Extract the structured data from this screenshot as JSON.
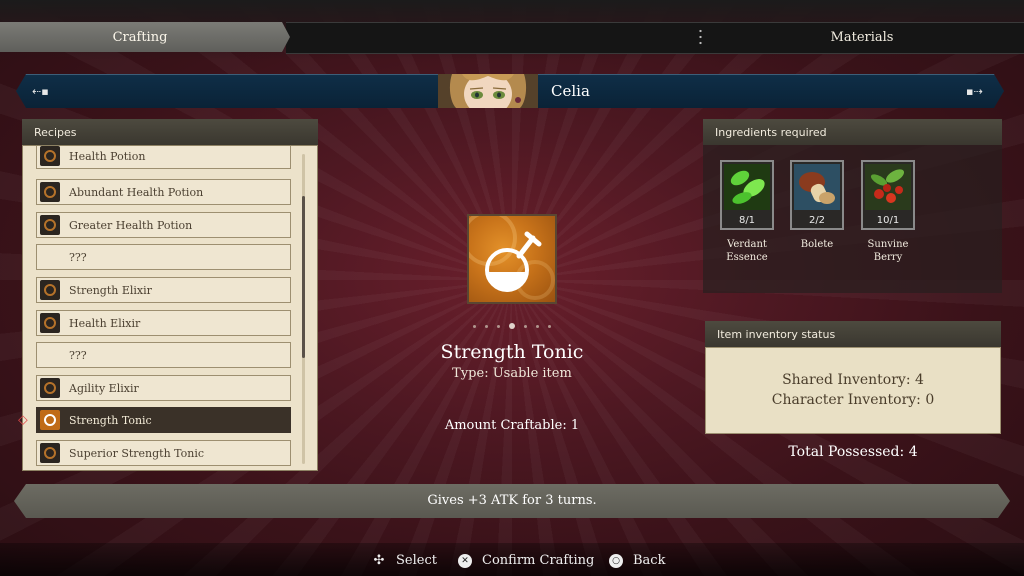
{
  "tabs": {
    "active": "Crafting",
    "other": "Materials"
  },
  "character": {
    "name": "Celia",
    "prev_icon": "arrow-left-icon",
    "next_icon": "arrow-right-icon"
  },
  "recipes": {
    "header": "Recipes",
    "items": [
      {
        "label": "Health Potion",
        "has_icon": true,
        "selected": false
      },
      {
        "label": "Abundant Health Potion",
        "has_icon": true,
        "selected": false
      },
      {
        "label": "Greater Health Potion",
        "has_icon": true,
        "selected": false
      },
      {
        "label": "???",
        "has_icon": false,
        "selected": false
      },
      {
        "label": "Strength Elixir",
        "has_icon": true,
        "selected": false
      },
      {
        "label": "Health Elixir",
        "has_icon": true,
        "selected": false
      },
      {
        "label": "???",
        "has_icon": false,
        "selected": false
      },
      {
        "label": "Agility Elixir",
        "has_icon": true,
        "selected": false
      },
      {
        "label": "Strength Tonic",
        "has_icon": true,
        "selected": true
      },
      {
        "label": "Superior Strength Tonic",
        "has_icon": true,
        "selected": false
      }
    ]
  },
  "item": {
    "name": "Strength Tonic",
    "type": "Type: Usable item",
    "amount_craftable": "Amount Craftable: 1",
    "icon": "potion-flask-icon",
    "page_count": 7,
    "page_active": 4
  },
  "ingredients": {
    "header": "Ingredients required",
    "list": [
      {
        "name": "Verdant Essence",
        "count": "8/1",
        "icon": "green-leaves-icon"
      },
      {
        "name": "Bolete",
        "count": "2/2",
        "icon": "mushroom-icon"
      },
      {
        "name": "Sunvine Berry",
        "count": "10/1",
        "icon": "red-berry-icon"
      }
    ]
  },
  "inventory": {
    "header": "Item inventory status",
    "shared": "Shared Inventory: 4",
    "character": "Character Inventory: 0",
    "total": "Total Possessed: 4"
  },
  "description": "Gives +3 ATK for 3 turns.",
  "prompts": [
    {
      "label": "Select",
      "icon": "dpad-icon"
    },
    {
      "label": "Confirm Crafting",
      "icon": "cross-button-icon"
    },
    {
      "label": "Back",
      "icon": "circle-button-icon"
    }
  ],
  "colors": {
    "selected_row": "#3a3128",
    "accent_orange": "#c8731a",
    "char_bar": "#0f2e47"
  }
}
